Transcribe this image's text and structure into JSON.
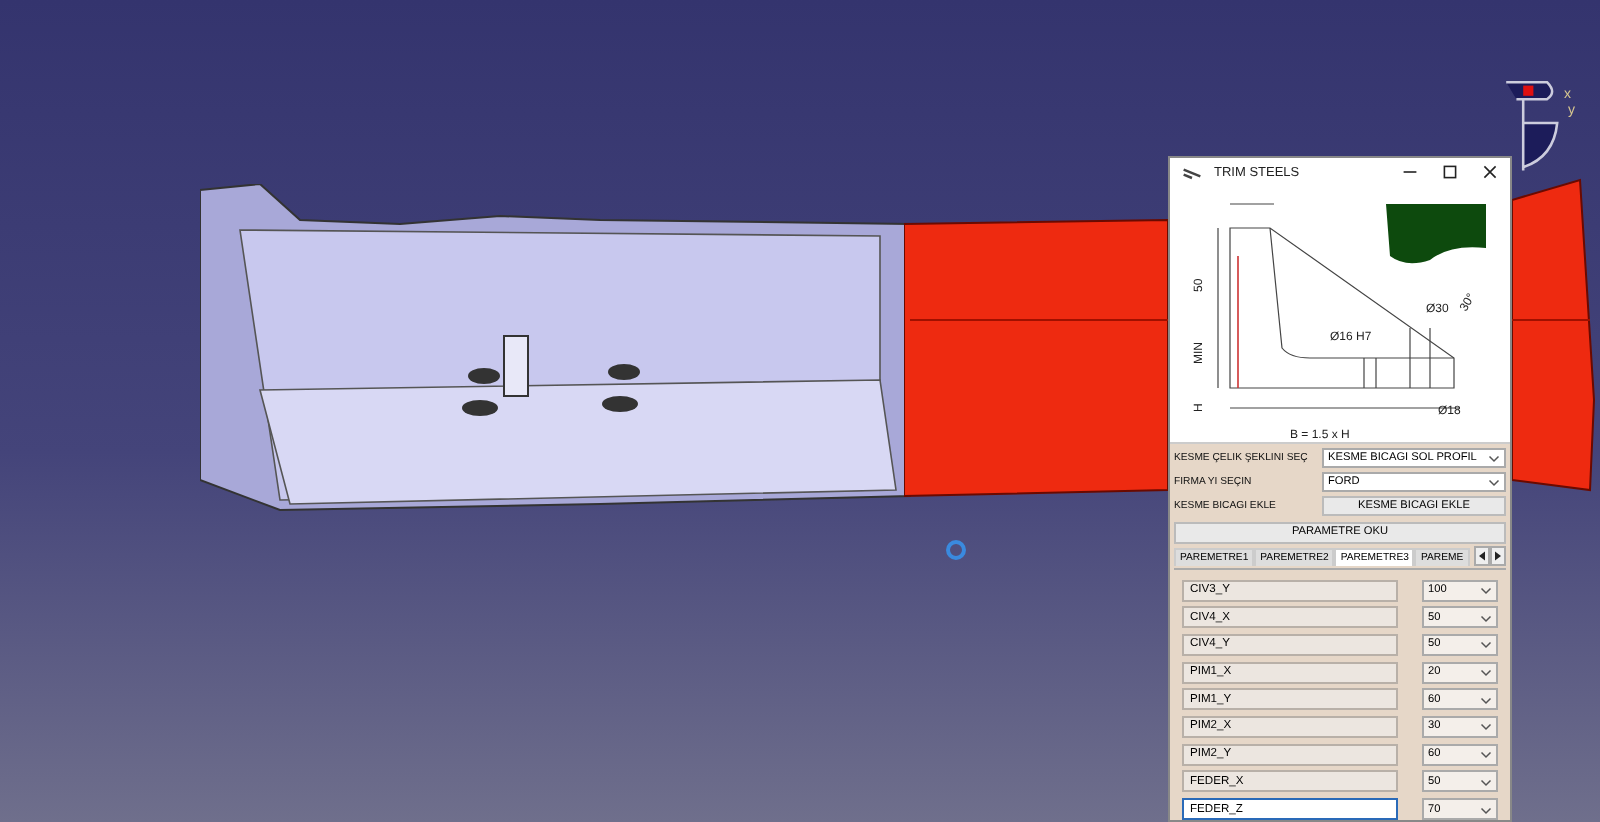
{
  "window": {
    "title": "TRIM STEELS"
  },
  "diagram": {
    "labels": [
      "50",
      "MIN",
      "H",
      "30°",
      "Ø30",
      "Ø16 H7",
      "Ø18",
      "B = 1.5 x H"
    ]
  },
  "form": [
    {
      "kind": "select",
      "label": "KESME ÇELIK ŞEKLINI SEÇ",
      "value": "KESME BICAGI SOL PROFIL"
    },
    {
      "kind": "select",
      "label": "FIRMA YI SEÇIN",
      "value": "FORD"
    },
    {
      "kind": "button",
      "label": "KESME BICAGI EKLE",
      "value": "KESME BICAGI EKLE"
    }
  ],
  "read_button": "PARAMETRE OKU",
  "tabs": [
    {
      "label": "PAREMETRE1",
      "selected": false
    },
    {
      "label": "PAREMETRE2",
      "selected": false
    },
    {
      "label": "PAREMETRE3",
      "selected": true
    },
    {
      "label": "PAREME",
      "selected": false
    }
  ],
  "params": [
    {
      "name": "CIV3_Y",
      "value": "100",
      "focused": false
    },
    {
      "name": "CIV4_X",
      "value": "50",
      "focused": false
    },
    {
      "name": "CIV4_Y",
      "value": "50",
      "focused": false
    },
    {
      "name": "PIM1_X",
      "value": "20",
      "focused": false
    },
    {
      "name": "PIM1_Y",
      "value": "60",
      "focused": false
    },
    {
      "name": "PIM2_X",
      "value": "30",
      "focused": false
    },
    {
      "name": "PIM2_Y",
      "value": "60",
      "focused": false
    },
    {
      "name": "FEDER_X",
      "value": "50",
      "focused": false
    },
    {
      "name": "FEDER_Z",
      "value": "70",
      "focused": true
    }
  ],
  "axis_labels": [
    "x",
    "y"
  ]
}
